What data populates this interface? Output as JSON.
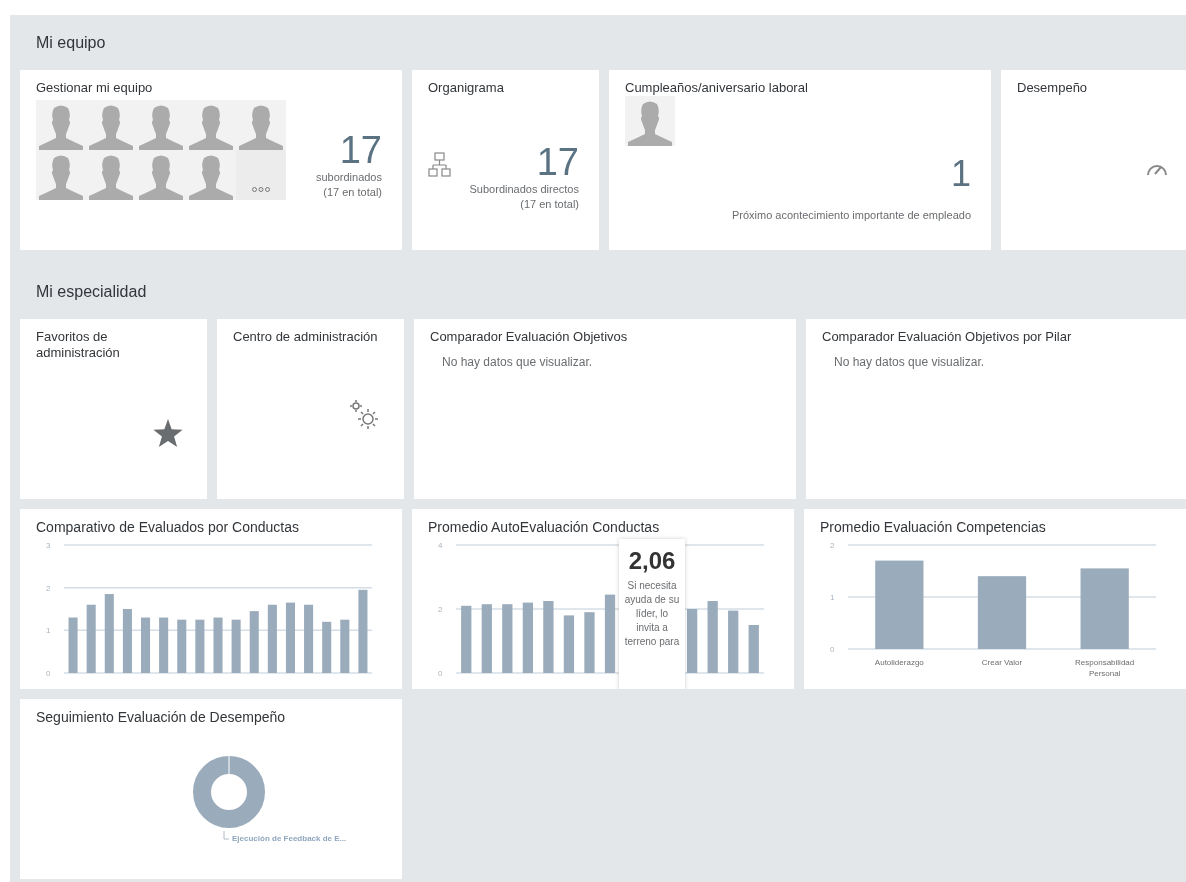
{
  "sections": [
    {
      "title": "Mi equipo",
      "tiles": [
        {
          "kind": "team",
          "title": "Gestionar mi equipo",
          "avatars": [
            {
              "kind": "placeholder"
            },
            {
              "kind": "placeholder"
            },
            {
              "kind": "placeholder"
            },
            {
              "kind": "placeholder"
            },
            {
              "kind": "placeholder"
            },
            {
              "kind": "placeholder"
            },
            {
              "kind": "placeholder"
            },
            {
              "kind": "placeholder"
            },
            {
              "kind": "placeholder"
            }
          ],
          "number": "17",
          "caption": [
            "subordinados",
            "(17 en total)"
          ]
        },
        {
          "kind": "org",
          "title": "Organigrama",
          "number": "17",
          "caption": [
            "Subordinados directos",
            "(17 en total)"
          ]
        },
        {
          "kind": "event",
          "title": "Cumpleaños/aniversario laboral",
          "avatars": [
            {
              "kind": "placeholder"
            }
          ],
          "number": "1",
          "caption": [
            "Próximo acontecimiento importante de empleado"
          ]
        },
        {
          "kind": "performance",
          "title": "Desempeño"
        }
      ]
    },
    {
      "title": "Mi especialidad",
      "tiles": [
        {
          "kind": "favorites",
          "title": "Favoritos de administración"
        },
        {
          "kind": "admin",
          "title": "Centro de administración"
        },
        {
          "kind": "empty",
          "title": "Comparador Evaluación Objetivos",
          "message": "No hay datos que visualizar."
        },
        {
          "kind": "empty",
          "title": "Comparador Evaluación Objetivos por Pilar",
          "message": "No hay datos que visualizar."
        },
        {
          "kind": "chart",
          "title": "Comparativo de Evaluados por Conductas",
          "chart_data": {
            "type": "bar",
            "ylim": [
              0,
              3
            ],
            "yticks": [
              0,
              1,
              2,
              3
            ],
            "values": [
              1.3,
              1.6,
              1.85,
              1.5,
              1.3,
              1.3,
              1.25,
              1.25,
              1.3,
              1.25,
              1.45,
              1.6,
              1.65,
              1.6,
              1.2,
              1.25,
              1.95
            ]
          }
        },
        {
          "kind": "chart",
          "title": "Promedio AutoEvaluación Conductas",
          "chart_data": {
            "type": "bar",
            "ylim": [
              0,
              4
            ],
            "yticks": [
              0,
              2,
              4
            ],
            "values": [
              2.1,
              2.15,
              2.15,
              2.2,
              2.25,
              1.8,
              1.9,
              2.45,
              null,
              null,
              null,
              2.0,
              2.25,
              1.95,
              1.5
            ]
          },
          "tooltip": {
            "value": "2,06",
            "text": "Si necesita ayuda de su líder, lo invita a terreno para"
          }
        },
        {
          "kind": "chart",
          "title": "Promedio Evaluación Competencias",
          "chart_data": {
            "type": "bar",
            "ylim": [
              0,
              2
            ],
            "yticks": [
              0,
              1,
              2
            ],
            "categories": [
              "Autoliderazgo",
              "Crear Valor",
              "Responsabilidad Personal"
            ],
            "values": [
              1.7,
              1.4,
              1.55
            ]
          }
        },
        {
          "kind": "donut",
          "title": "Seguimiento Evaluación de Desempeño",
          "label": "Ejecución de Feedback de E..."
        }
      ]
    }
  ]
}
